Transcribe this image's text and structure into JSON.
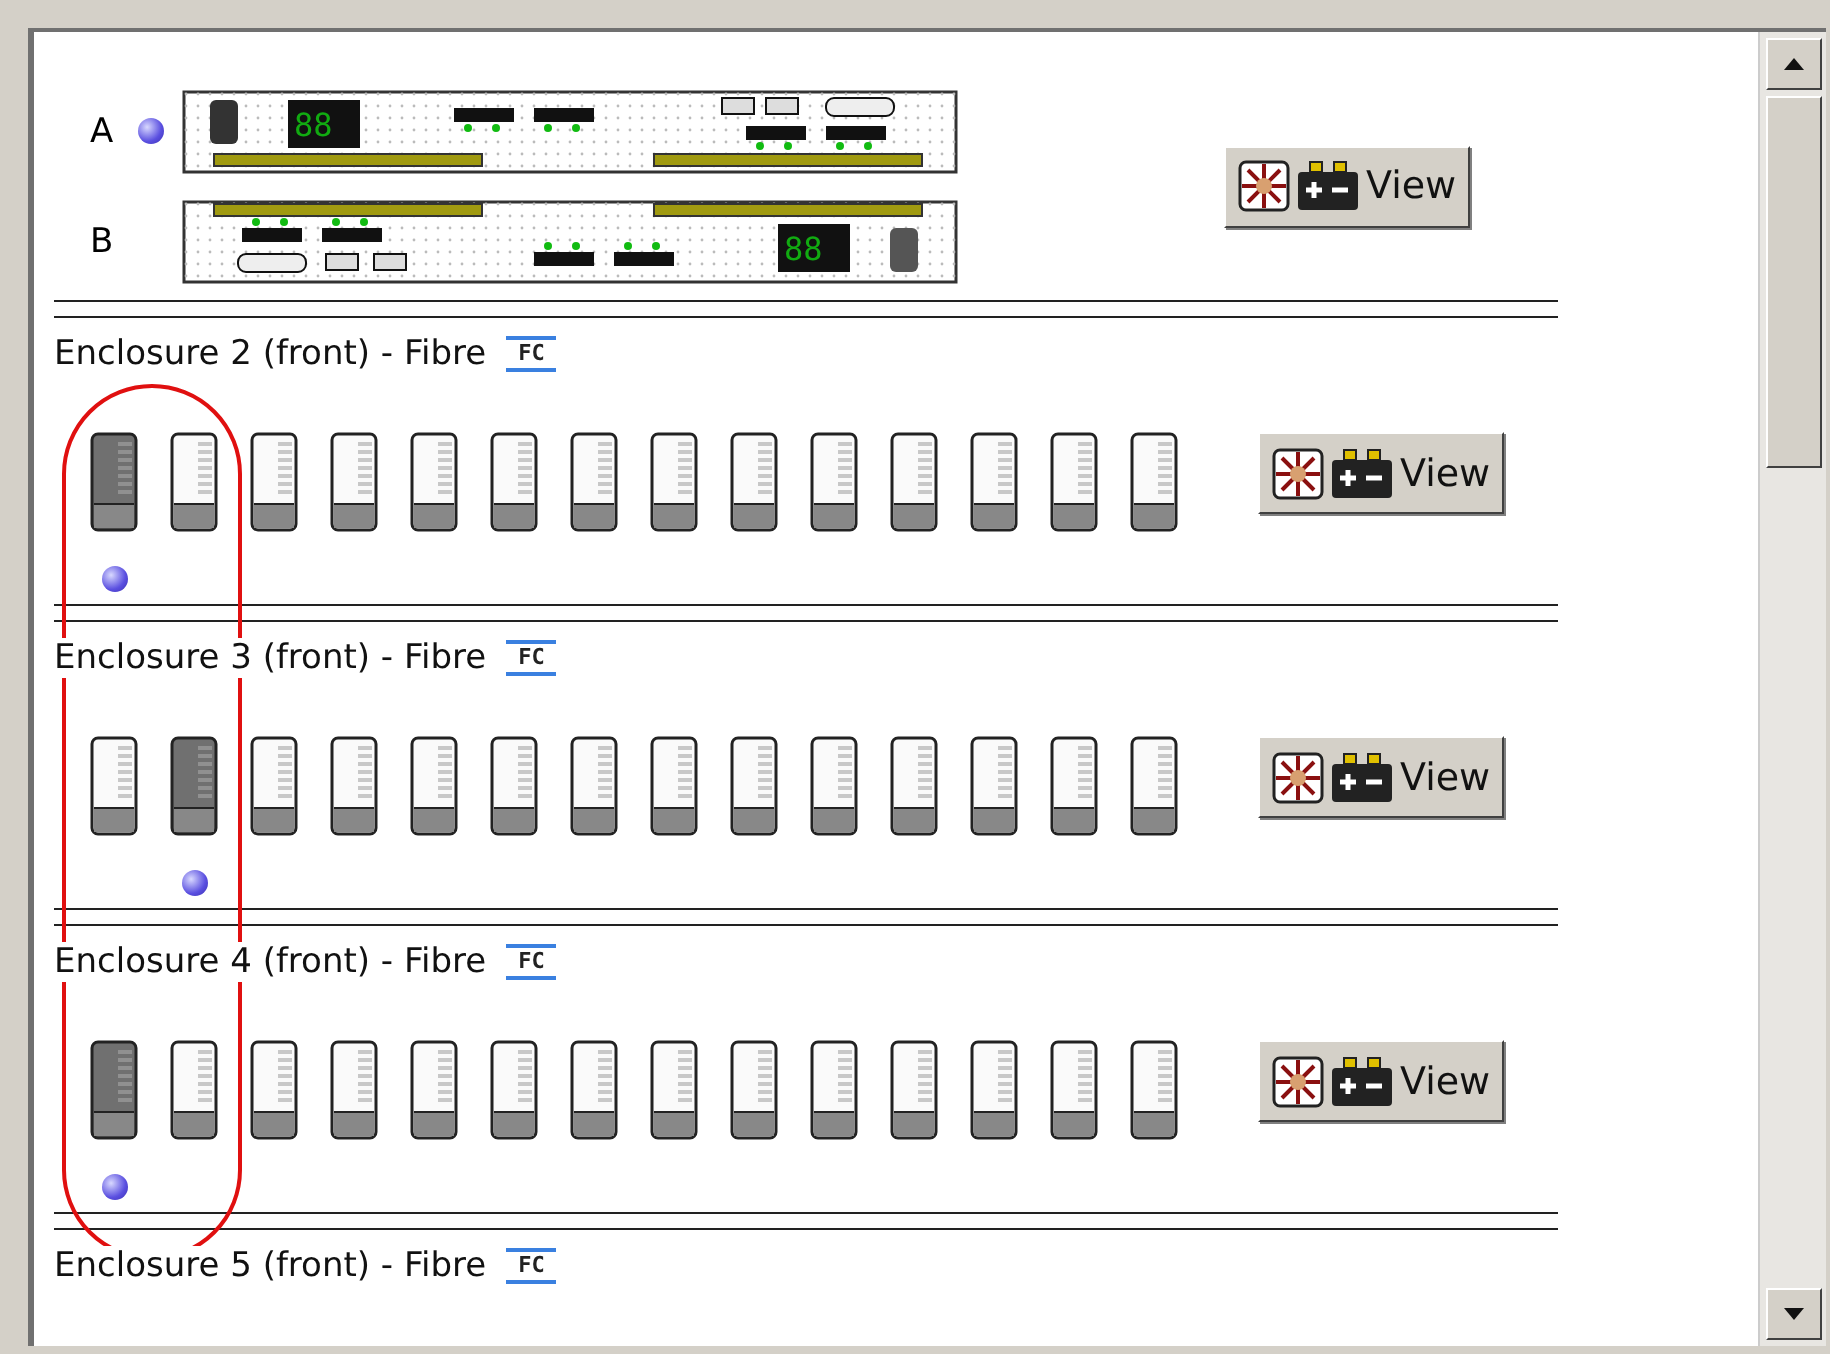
{
  "controllers": [
    {
      "label": "A",
      "selected": true,
      "kind": "upper",
      "display": "88"
    },
    {
      "label": "B",
      "selected": false,
      "kind": "lower",
      "display": "88"
    }
  ],
  "controller_button": {
    "label": "View"
  },
  "enclosures": [
    {
      "title": "Enclosure 2 (front) - Fibre",
      "tag": "FC",
      "button": "View",
      "drives": [
        {
          "selected": true
        },
        {
          "selected": false
        },
        {
          "selected": false
        },
        {
          "selected": false
        },
        {
          "selected": false
        },
        {
          "selected": false
        },
        {
          "selected": false
        },
        {
          "selected": false
        },
        {
          "selected": false
        },
        {
          "selected": false
        },
        {
          "selected": false
        },
        {
          "selected": false
        },
        {
          "selected": false
        },
        {
          "selected": false
        }
      ]
    },
    {
      "title": "Enclosure 3 (front) - Fibre",
      "tag": "FC",
      "button": "View",
      "drives": [
        {
          "selected": false
        },
        {
          "selected": true
        },
        {
          "selected": false
        },
        {
          "selected": false
        },
        {
          "selected": false
        },
        {
          "selected": false
        },
        {
          "selected": false
        },
        {
          "selected": false
        },
        {
          "selected": false
        },
        {
          "selected": false
        },
        {
          "selected": false
        },
        {
          "selected": false
        },
        {
          "selected": false
        },
        {
          "selected": false
        }
      ]
    },
    {
      "title": "Enclosure 4 (front) - Fibre",
      "tag": "FC",
      "button": "View",
      "drives": [
        {
          "selected": true
        },
        {
          "selected": false
        },
        {
          "selected": false
        },
        {
          "selected": false
        },
        {
          "selected": false
        },
        {
          "selected": false
        },
        {
          "selected": false
        },
        {
          "selected": false
        },
        {
          "selected": false
        },
        {
          "selected": false
        },
        {
          "selected": false
        },
        {
          "selected": false
        },
        {
          "selected": false
        },
        {
          "selected": false
        }
      ]
    },
    {
      "title": "Enclosure 5 (front) - Fibre",
      "tag": "FC"
    }
  ]
}
